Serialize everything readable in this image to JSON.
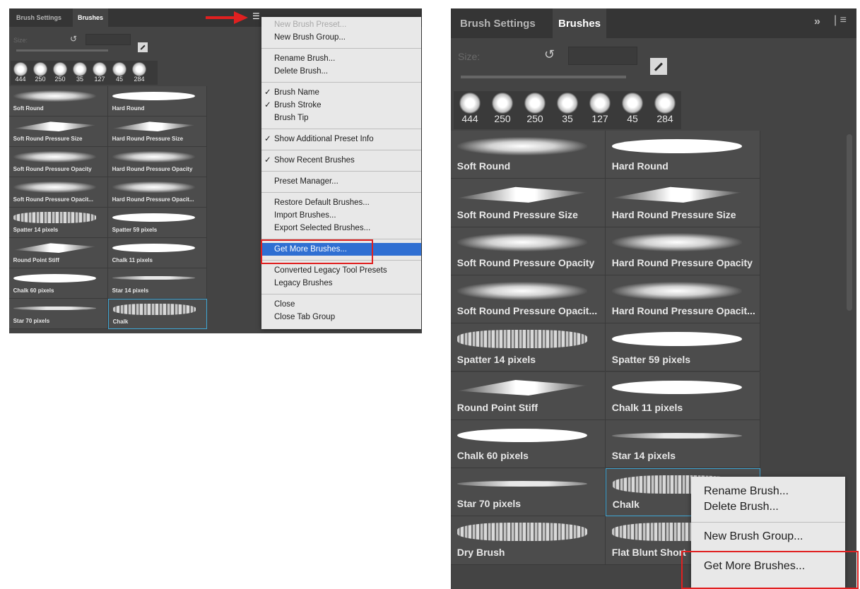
{
  "colors": {
    "panel_bg": "#444444",
    "tab_bar": "#353535",
    "menu_bg": "#e8e8e8",
    "highlight": "#2f6fd2",
    "annotation_red": "#e02020",
    "selection_border": "#3fa7d6"
  },
  "left_panel": {
    "tabs": [
      "Brush Settings",
      "Brushes"
    ],
    "size_label": "Size:",
    "recent_sizes": [
      "444",
      "250",
      "250",
      "35",
      "127",
      "45",
      "284"
    ],
    "brushes": [
      {
        "label": "Soft Round",
        "style": "soft"
      },
      {
        "label": "Hard Round",
        "style": "hard"
      },
      {
        "label": "Soft Round Pressure Size",
        "style": "taper"
      },
      {
        "label": "Hard Round Pressure Size",
        "style": "taper"
      },
      {
        "label": "Soft Round Pressure Opacity",
        "style": "soft"
      },
      {
        "label": "Hard Round Pressure Opacity",
        "style": "soft"
      },
      {
        "label": "Soft Round Pressure Opacit...",
        "style": "soft"
      },
      {
        "label": "Hard Round Pressure Opacit...",
        "style": "soft"
      },
      {
        "label": "Spatter 14 pixels",
        "style": "rough"
      },
      {
        "label": "Spatter 59 pixels",
        "style": "hard"
      },
      {
        "label": "Round Point Stiff",
        "style": "taper"
      },
      {
        "label": "Chalk 11 pixels",
        "style": "hard"
      },
      {
        "label": "Chalk 60 pixels",
        "style": "hard"
      },
      {
        "label": "Star 14 pixels",
        "style": "thin"
      },
      {
        "label": "Star 70 pixels",
        "style": "thin"
      },
      {
        "label": "Chalk",
        "style": "rough"
      }
    ],
    "menu": {
      "groups": [
        [
          {
            "label": "New Brush Preset...",
            "disabled": true
          },
          {
            "label": "New Brush Group..."
          }
        ],
        [
          {
            "label": "Rename Brush..."
          },
          {
            "label": "Delete Brush..."
          }
        ],
        [
          {
            "label": "Brush Name",
            "checked": true
          },
          {
            "label": "Brush Stroke",
            "checked": true
          },
          {
            "label": "Brush Tip"
          }
        ],
        [
          {
            "label": "Show Additional Preset Info",
            "checked": true
          }
        ],
        [
          {
            "label": "Show Recent Brushes",
            "checked": true
          }
        ],
        [
          {
            "label": "Preset Manager..."
          }
        ],
        [
          {
            "label": "Restore Default Brushes..."
          },
          {
            "label": "Import Brushes..."
          },
          {
            "label": "Export Selected Brushes..."
          }
        ],
        [
          {
            "label": "Get More Brushes...",
            "highlighted": true
          }
        ],
        [
          {
            "label": "Converted Legacy Tool Presets"
          },
          {
            "label": "Legacy Brushes"
          }
        ],
        [
          {
            "label": "Close"
          },
          {
            "label": "Close Tab Group"
          }
        ]
      ]
    }
  },
  "right_panel": {
    "tabs": [
      "Brush Settings",
      "Brushes"
    ],
    "flyout_icon": "»",
    "size_label": "Size:",
    "recent_sizes": [
      "444",
      "250",
      "250",
      "35",
      "127",
      "45",
      "284"
    ],
    "brushes": [
      {
        "label": "Soft Round",
        "style": "soft"
      },
      {
        "label": "Hard Round",
        "style": "hard"
      },
      {
        "label": "Soft Round Pressure Size",
        "style": "taper"
      },
      {
        "label": "Hard Round Pressure Size",
        "style": "taper"
      },
      {
        "label": "Soft Round Pressure Opacity",
        "style": "soft"
      },
      {
        "label": "Hard Round Pressure Opacity",
        "style": "soft"
      },
      {
        "label": "Soft Round Pressure Opacit...",
        "style": "soft"
      },
      {
        "label": "Hard Round Pressure Opacit...",
        "style": "soft"
      },
      {
        "label": "Spatter 14 pixels",
        "style": "rough"
      },
      {
        "label": "Spatter 59 pixels",
        "style": "hard"
      },
      {
        "label": "Round Point Stiff",
        "style": "taper"
      },
      {
        "label": "Chalk 11 pixels",
        "style": "hard"
      },
      {
        "label": "Chalk 60 pixels",
        "style": "hard"
      },
      {
        "label": "Star 14 pixels",
        "style": "thin"
      },
      {
        "label": "Star 70 pixels",
        "style": "thin"
      },
      {
        "label": "Chalk",
        "style": "rough"
      },
      {
        "label": "Dry Brush",
        "style": "rough"
      },
      {
        "label": "Flat Blunt Short",
        "style": "rough"
      }
    ],
    "context_menu": {
      "groups": [
        [
          {
            "label": "Rename Brush..."
          },
          {
            "label": "Delete Brush..."
          }
        ],
        [
          {
            "label": "New Brush Group..."
          }
        ],
        [
          {
            "label": "Get More Brushes..."
          }
        ]
      ]
    }
  }
}
